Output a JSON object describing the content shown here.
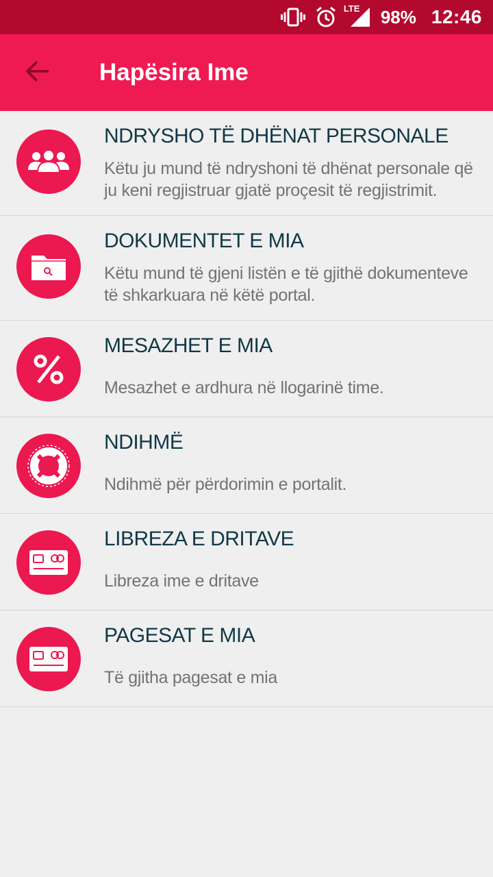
{
  "status_bar": {
    "battery": "98%",
    "time": "12:46",
    "network_label": "LTE",
    "icons": [
      "vibrate-icon",
      "alarm-icon",
      "signal-icon"
    ]
  },
  "app_bar": {
    "title": "Hapësira Ime",
    "back_icon": "arrow-left-icon"
  },
  "colors": {
    "status_bar": "#b3092f",
    "app_bar": "#ef1a52",
    "accent": "#ec1850",
    "title_text": "#113846",
    "desc_text": "#737373",
    "background": "#efefef"
  },
  "menu": {
    "items": [
      {
        "title": "NDRYSHO TË DHËNAT PERSONALE",
        "description": "Këtu ju mund të ndryshoni të dhënat personale që ju keni regjistruar gjatë proçesit të regjistrimit.",
        "icon": "users-group-icon"
      },
      {
        "title": "DOKUMENTET E MIA",
        "description": "Këtu mund të gjeni listën e të gjithë dokumenteve të shkarkuara në këtë portal.",
        "icon": "folder-search-icon"
      },
      {
        "title": "MESAZHET E MIA",
        "description": "Mesazhet e ardhura në llogarinë time.",
        "icon": "percent-icon"
      },
      {
        "title": "NDIHMË",
        "description": "Ndihmë për përdorimin e portalit.",
        "icon": "lifebuoy-icon"
      },
      {
        "title": "LIBREZA E DRITAVE",
        "description": "Libreza ime e dritave",
        "icon": "credit-card-icon"
      },
      {
        "title": "PAGESAT E MIA",
        "description": "Të gjitha pagesat e mia",
        "icon": "credit-card-icon"
      }
    ]
  }
}
